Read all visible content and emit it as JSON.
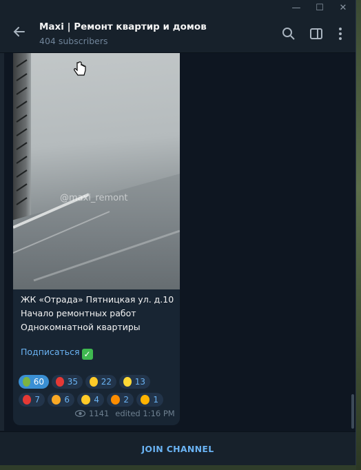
{
  "window": {
    "minimize_icon": "minimize-icon",
    "maximize_icon": "maximize-icon",
    "close_icon": "close-icon"
  },
  "header": {
    "title": "Maxi | Ремонт квартир и домов",
    "subtitle": "404 subscribers"
  },
  "message": {
    "watermark": "@maxi_remont",
    "lines": [
      "ЖК «Отрада» Пятницкая ул. д.10",
      "Начало ремонтных работ",
      "Однокомнатной квартиры"
    ],
    "link_text": "Подписаться",
    "reactions": [
      {
        "emoji": "champagne",
        "count": "60",
        "color": "#7cb342",
        "active": true
      },
      {
        "emoji": "strawberry",
        "count": "35",
        "color": "#e53935",
        "active": false
      },
      {
        "emoji": "thumbs-up",
        "count": "22",
        "color": "#ffca28",
        "active": false
      },
      {
        "emoji": "lightning",
        "count": "13",
        "color": "#fdd835",
        "active": false
      },
      {
        "emoji": "heart",
        "count": "7",
        "color": "#e53935",
        "active": false
      },
      {
        "emoji": "trophy",
        "count": "6",
        "color": "#f9a825",
        "active": false
      },
      {
        "emoji": "clapping-hands",
        "count": "4",
        "color": "#ffca28",
        "active": false
      },
      {
        "emoji": "party-popper",
        "count": "2",
        "color": "#fb8c00",
        "active": false
      },
      {
        "emoji": "smiling-hearts-face",
        "count": "1",
        "color": "#ffb300",
        "active": false
      }
    ],
    "views": "1141",
    "edited": "edited 1:16 PM"
  },
  "footer": {
    "join_label": "JOIN CHANNEL"
  },
  "colors": {
    "accent": "#6ab3f3",
    "bubble": "#182533",
    "background": "#0e1621"
  }
}
